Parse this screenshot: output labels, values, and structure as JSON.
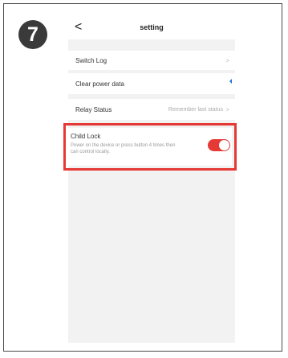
{
  "step_number": "7",
  "header": {
    "back_icon": "chevron-left-icon",
    "back_glyph": "<",
    "title": "setting"
  },
  "rows": [
    {
      "label": "Switch Log",
      "chevron": ">"
    },
    {
      "label": "Clear power data"
    },
    {
      "label": "Relay Status",
      "value": "Remember last status",
      "chevron": ">"
    }
  ],
  "child_lock": {
    "label": "Child Lock",
    "description": "Power on the device or press button 4 times then can control locally.",
    "toggle_on": true
  },
  "colors": {
    "accent_red": "#e53935",
    "marker_blue": "#1e73d6",
    "badge_dark": "#3a3a3a"
  }
}
